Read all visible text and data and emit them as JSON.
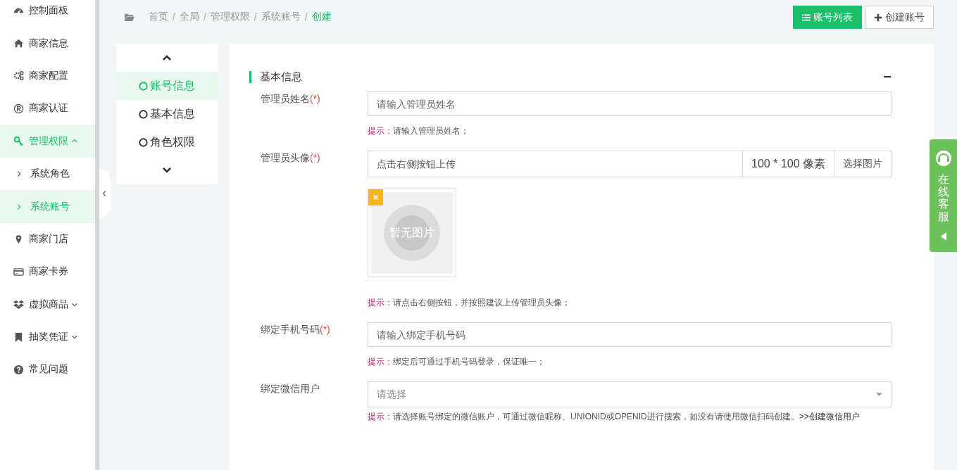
{
  "sidebar": {
    "items": [
      {
        "label": "控制面板",
        "kind": "link",
        "selected": false
      },
      {
        "label": "商家信息",
        "kind": "link",
        "selected": false
      },
      {
        "label": "商家配置",
        "kind": "link",
        "selected": false
      },
      {
        "label": "商家认证",
        "kind": "link",
        "selected": false
      },
      {
        "label": "管理权限",
        "kind": "menu",
        "expanded": true,
        "selected": true,
        "children": [
          {
            "label": "系统角色",
            "selected": false
          },
          {
            "label": "系统账号",
            "selected": true
          }
        ]
      },
      {
        "label": "商家门店",
        "kind": "link",
        "selected": false
      },
      {
        "label": "商家卡券",
        "kind": "link",
        "selected": false
      },
      {
        "label": "虚拟商品",
        "kind": "menu",
        "expanded": false,
        "selected": false
      },
      {
        "label": "抽奖凭证",
        "kind": "menu",
        "expanded": false,
        "selected": false
      },
      {
        "label": "常见问题",
        "kind": "link",
        "selected": false
      }
    ]
  },
  "breadcrumb_separator": "/",
  "breadcrumb": [
    {
      "label": "首页",
      "current": false
    },
    {
      "label": "全局",
      "current": false
    },
    {
      "label": "管理权限",
      "current": false
    },
    {
      "label": "系统账号",
      "current": false
    },
    {
      "label": "创建",
      "current": true
    }
  ],
  "buttons": [
    {
      "label": "账号列表",
      "kind": "primary"
    },
    {
      "label": "创建账号",
      "kind": "default"
    }
  ],
  "steps": [
    {
      "label": "账号信息",
      "selected": true
    },
    {
      "label": "基本信息",
      "selected": false
    },
    {
      "label": "角色权限",
      "selected": false
    }
  ],
  "section": {
    "title": "基本信息",
    "collapse_symbol": "−"
  },
  "fields": [
    {
      "kind": "text",
      "label": "管理员姓名",
      "required_mark": "(*)",
      "placeholder": "请输入管理员姓名",
      "hint_label": "提示：",
      "hint": "请输入管理员姓名；"
    },
    {
      "kind": "image",
      "label": "管理员头像",
      "required_mark": "(*)",
      "placeholder": "点击右侧按钮上传",
      "size_note": "100 * 100 像素",
      "button": "选择图片",
      "empty_image_text": "暂无图片",
      "hint_label": "提示：",
      "hint": "请点击右侧按钮，并按照建议上传管理员头像；"
    },
    {
      "kind": "text",
      "label": "绑定手机号码",
      "required_mark": "(*)",
      "placeholder": "请输入绑定手机号码",
      "hint_label": "提示：",
      "hint": "绑定后可通过手机号码登录，保证唯一；"
    },
    {
      "kind": "select",
      "label": "绑定微信用户",
      "placeholder": "请选择",
      "hint_label": "提示：",
      "hint": "请选择账号绑定的微信账户，可通过微信昵称、UNIONID或OPENID进行搜索，如没有请使用微信扫码创建。",
      "hint_link": ">>创建微信用户"
    }
  ],
  "service_tab": {
    "label": "在线客服"
  }
}
